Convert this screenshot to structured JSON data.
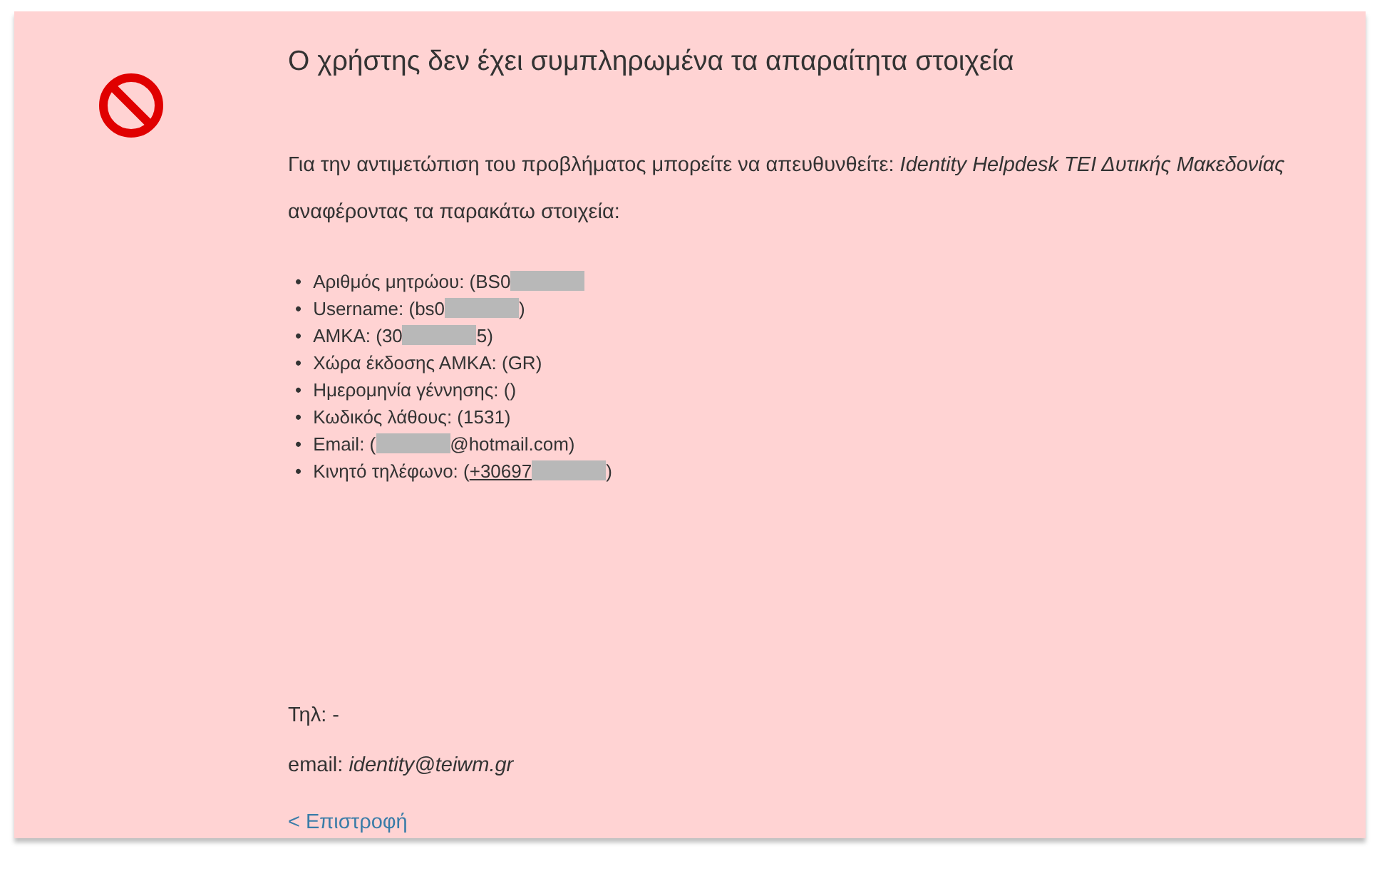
{
  "title": "Ο χρήστης δεν έχει συμπληρωμένα τα απαραίτητα στοιχεία",
  "message": "Για την αντιμετώπιση του προβλήματος μπορείτε να απευθυνθείτε: *Identity Helpdesk ΤΕΙ Δυτικής Μακεδονίας* αναφέροντας τα παρακάτω στοιχεία:",
  "details": [
    {
      "bullet": "•",
      "parts": [
        {
          "kind": "text",
          "text": "Αριθμός μητρώου: (BS0"
        },
        {
          "kind": "redacted"
        }
      ]
    },
    {
      "bullet": "•",
      "parts": [
        {
          "kind": "text",
          "text": "Username: (bs0"
        },
        {
          "kind": "redacted"
        },
        {
          "kind": "text",
          "text": ")"
        }
      ]
    },
    {
      "bullet": "•",
      "parts": [
        {
          "kind": "text",
          "text": "ΑΜΚΑ: (30"
        },
        {
          "kind": "redacted"
        },
        {
          "kind": "text",
          "text": "5)"
        }
      ]
    },
    {
      "bullet": "•",
      "parts": [
        {
          "kind": "text",
          "text": "Χώρα έκδοσης ΑΜΚΑ: (GR)"
        }
      ]
    },
    {
      "bullet": "•",
      "parts": [
        {
          "kind": "text",
          "text": "Ημερομηνία γέννησης: ()"
        }
      ]
    },
    {
      "bullet": "•",
      "parts": [
        {
          "kind": "text",
          "text": "Κωδικός λάθους: (1531)"
        }
      ]
    },
    {
      "bullet": "•",
      "parts": [
        {
          "kind": "text",
          "text": "Email: ("
        },
        {
          "kind": "redacted"
        },
        {
          "kind": "text",
          "text": "@hotmail.com)"
        }
      ]
    },
    {
      "bullet": "•",
      "parts": [
        {
          "kind": "text",
          "text": "Κινητό τηλέφωνο: ("
        },
        {
          "kind": "link",
          "text": "+30697"
        },
        {
          "kind": "redacted"
        },
        {
          "kind": "text",
          "text": ")"
        }
      ]
    }
  ],
  "contact": {
    "phone": "Τηλ: -",
    "email_label": "email:",
    "email": "identity@teiwm.gr"
  },
  "back_link": "< Επιστροφή"
}
